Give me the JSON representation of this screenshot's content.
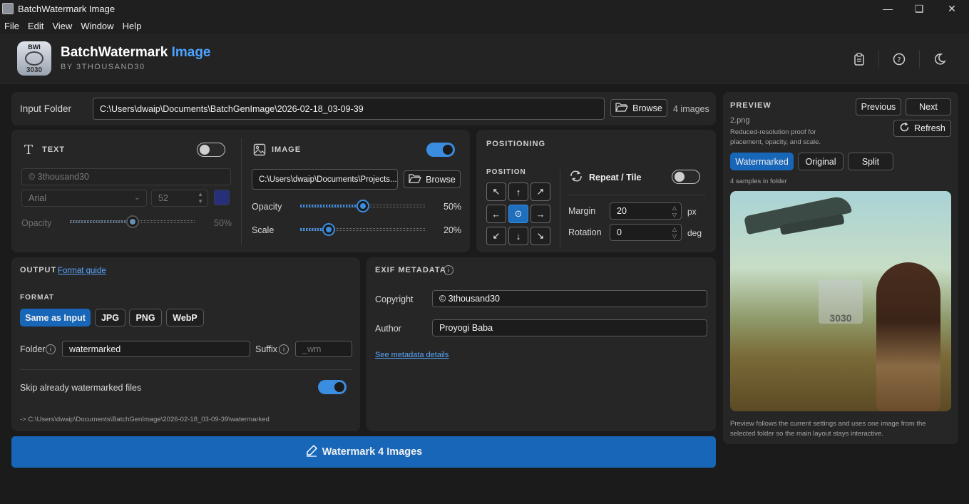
{
  "window": {
    "title": "BatchWatermark Image"
  },
  "menu": [
    "File",
    "Edit",
    "View",
    "Window",
    "Help"
  ],
  "header": {
    "logo_top": "BWI",
    "logo_bottom": "3030",
    "brand_main": "BatchWatermark",
    "brand_accent": "Image",
    "byline": "BY 3THOUSAND30"
  },
  "input": {
    "label": "Input Folder",
    "path": "C:\\Users\\dwaip\\Documents\\BatchGenImage\\2026-02-18_03-09-39",
    "browse": "Browse",
    "count": "4 images"
  },
  "text_panel": {
    "title": "TEXT",
    "enabled": false,
    "text": "© 3thousand30",
    "font": "Arial",
    "size": "52",
    "color": "#26307a",
    "opacity_label": "Opacity",
    "opacity_value": "50%",
    "opacity": 0.5
  },
  "image_panel": {
    "title": "IMAGE",
    "enabled": true,
    "path": "C:\\Users\\dwaip\\Documents\\Projects...",
    "browse": "Browse",
    "opacity_label": "Opacity",
    "opacity_value": "50%",
    "opacity": 0.5,
    "scale_label": "Scale",
    "scale_value": "20%",
    "scale": 0.2
  },
  "positioning": {
    "title": "POSITIONING",
    "position_label": "POSITION",
    "arrows": [
      "↖",
      "↑",
      "↗",
      "←",
      "⊙",
      "→",
      "↙",
      "↓",
      "↘"
    ],
    "selected_index": 4,
    "repeat_label": "Repeat / Tile",
    "repeat_enabled": false,
    "margin_label": "Margin",
    "margin_value": "20",
    "margin_unit": "px",
    "rotation_label": "Rotation",
    "rotation_value": "0",
    "rotation_unit": "deg"
  },
  "output": {
    "title": "OUTPUT",
    "guide_link": "Format guide",
    "format_label": "FORMAT",
    "formats": [
      "Same as Input",
      "JPG",
      "PNG",
      "WebP"
    ],
    "selected_format": 0,
    "folder_label": "Folder",
    "folder_value": "watermarked",
    "suffix_label": "Suffix",
    "suffix_placeholder": "_wm",
    "skip_label": "Skip already watermarked files",
    "skip_enabled": true,
    "output_path": "-> C:\\Users\\dwaip\\Documents\\BatchGenImage\\2026-02-18_03-09-39\\watermarked"
  },
  "exif": {
    "title": "EXIF METADATA",
    "copyright_label": "Copyright",
    "copyright_value": "© 3thousand30",
    "author_label": "Author",
    "author_value": "Proyogi Baba",
    "details_link": "See metadata details"
  },
  "action": {
    "label": "Watermark 4 Images"
  },
  "preview": {
    "title": "PREVIEW",
    "filename": "2.png",
    "desc": "Reduced-resolution proof for placement, opacity, and scale.",
    "previous": "Previous",
    "next": "Next",
    "refresh": "Refresh",
    "tabs": [
      "Watermarked",
      "Original",
      "Split"
    ],
    "selected_tab": 0,
    "samples": "4 samples in folder",
    "watermark_text": "3030",
    "footer": "Preview follows the current settings and uses one image from the selected folder so the main layout stays interactive."
  }
}
